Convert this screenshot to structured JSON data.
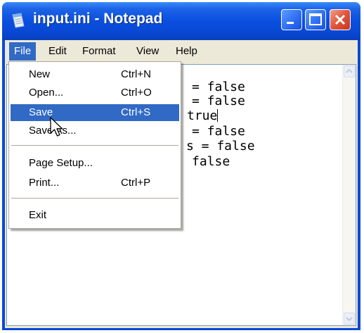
{
  "window": {
    "title": "input.ini - Notepad"
  },
  "menubar": {
    "items": [
      {
        "label": "File",
        "active": true
      },
      {
        "label": "Edit",
        "active": false
      },
      {
        "label": "Format",
        "active": false
      },
      {
        "label": "View",
        "active": false
      },
      {
        "label": "Help",
        "active": false
      }
    ]
  },
  "editor": {
    "visible_fragments": [
      "= false",
      "= false",
      "true",
      "= false",
      "s = false",
      "false"
    ]
  },
  "file_menu": {
    "items": [
      {
        "label": "New",
        "shortcut": "Ctrl+N"
      },
      {
        "label": "Open...",
        "shortcut": "Ctrl+O"
      },
      {
        "label": "Save",
        "shortcut": "Ctrl+S",
        "highlighted": true
      },
      {
        "label": "Save As...",
        "shortcut": ""
      },
      {
        "label": "Page Setup...",
        "shortcut": ""
      },
      {
        "label": "Print...",
        "shortcut": "Ctrl+P"
      },
      {
        "label": "Exit",
        "shortcut": ""
      }
    ]
  },
  "icons": {
    "app": "notepad-icon",
    "minimize": "minimize-icon",
    "maximize": "maximize-icon",
    "close": "close-icon",
    "cursor": "mouse-pointer-icon"
  },
  "colors": {
    "titlebar": "#0a4fe0",
    "menu_highlight": "#316ac5",
    "close_button": "#e0553a",
    "chrome": "#ece9d8"
  }
}
